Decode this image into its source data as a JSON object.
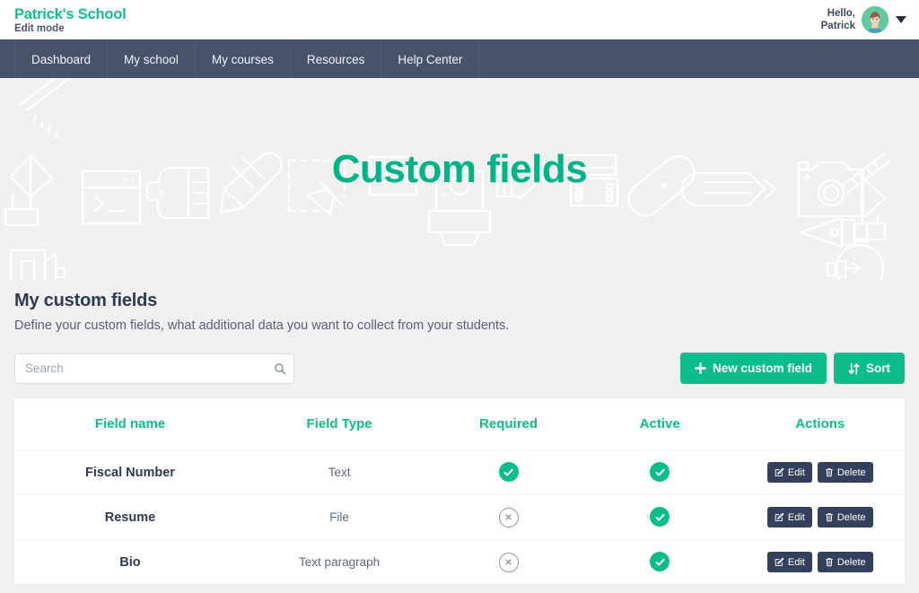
{
  "header": {
    "brand_title": "Patrick's School",
    "brand_subtitle": "Edit mode",
    "greeting_line1": "Hello,",
    "greeting_line2": "Patrick",
    "avatar_label": "user-avatar",
    "caret_label": "chevron-down-icon"
  },
  "nav": {
    "items": [
      {
        "label": "Dashboard"
      },
      {
        "label": "My school"
      },
      {
        "label": "My courses"
      },
      {
        "label": "Resources"
      },
      {
        "label": "Help Center"
      }
    ]
  },
  "hero": {
    "title": "Custom fields"
  },
  "main": {
    "section_title": "My custom fields",
    "section_description": "Define your custom fields, what additional data you want to collect from your students.",
    "search": {
      "placeholder": "Search",
      "value": "",
      "icon": "search-icon"
    },
    "buttons": {
      "new_field": {
        "label": "New custom field",
        "icon": "plus-icon"
      },
      "sort": {
        "label": "Sort",
        "icon": "sort-arrows-icon"
      }
    },
    "table": {
      "columns": [
        "Field name",
        "Field Type",
        "Required",
        "Active",
        "Actions"
      ],
      "rows": [
        {
          "field_name": "Fiscal Number",
          "field_type": "Text",
          "required": true,
          "active": true,
          "edit_label": "Edit",
          "delete_label": "Delete"
        },
        {
          "field_name": "Resume",
          "field_type": "File",
          "required": false,
          "active": true,
          "edit_label": "Edit",
          "delete_label": "Delete"
        },
        {
          "field_name": "Bio",
          "field_type": "Text paragraph",
          "required": false,
          "active": true,
          "edit_label": "Edit",
          "delete_label": "Delete"
        }
      ]
    }
  },
  "colors": {
    "brand_green": "#0cbd8b",
    "nav_dark": "#47536b",
    "page_bg": "#f0f0f1",
    "text_dark": "#2d3a4f",
    "button_dark": "#33415c"
  }
}
